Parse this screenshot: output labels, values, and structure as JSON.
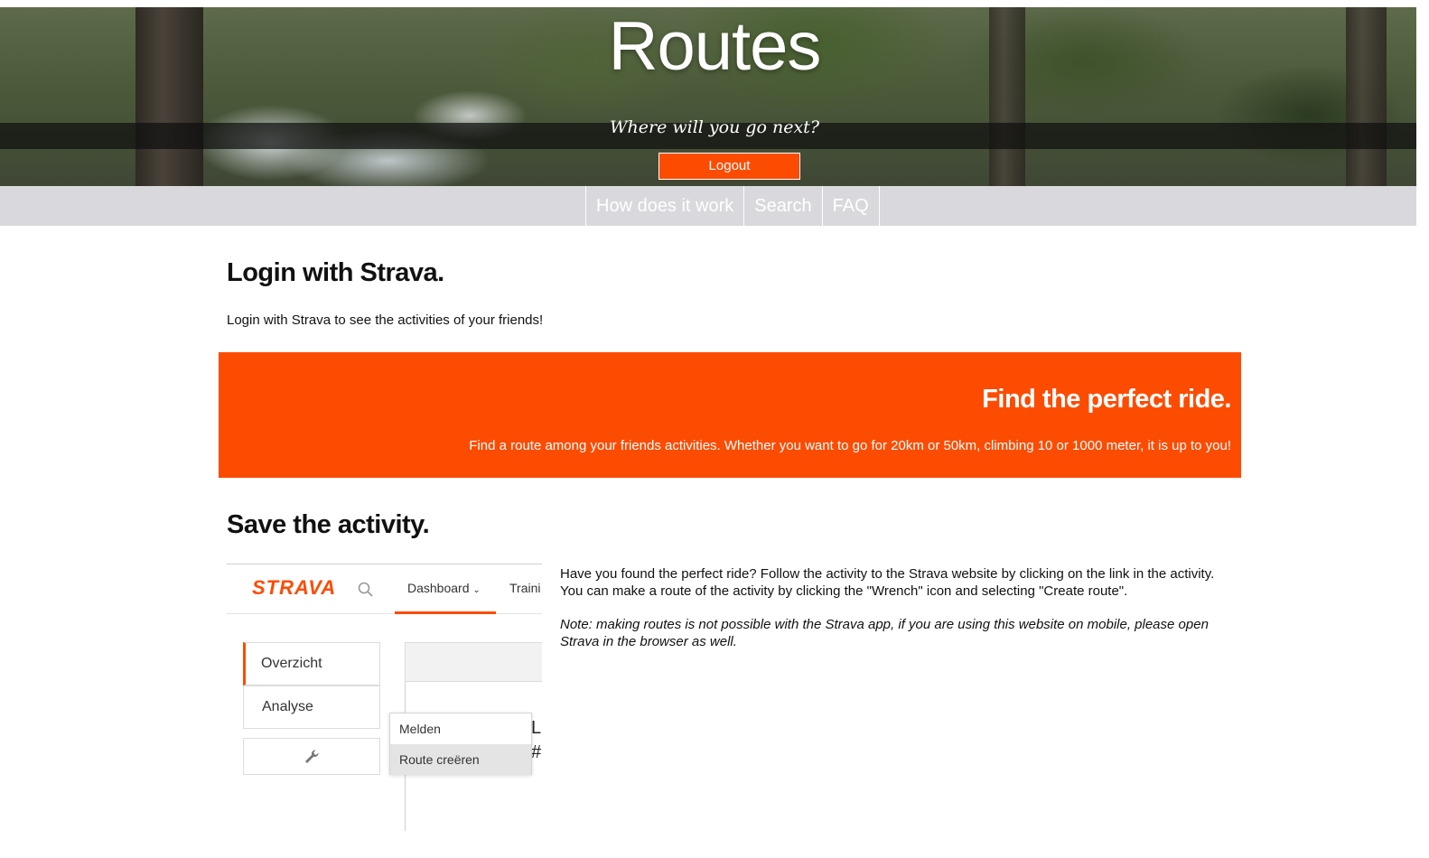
{
  "hero": {
    "title": "Routes",
    "tagline": "Where will you go next?",
    "logout_label": "Logout"
  },
  "nav": {
    "items": [
      {
        "label": "How does it work"
      },
      {
        "label": "Search"
      },
      {
        "label": "FAQ"
      }
    ]
  },
  "login": {
    "heading": "Login with Strava.",
    "text": "Login with Strava to see the activities of your friends!"
  },
  "promo": {
    "heading": "Find the perfect ride.",
    "text": "Find a route among your friends activities. Whether you want to go for 20km or 50km, climbing 10 or 1000 meter, it is up to you!",
    "background_color": "#fc4c02"
  },
  "save": {
    "heading": "Save the activity.",
    "description": "Have you found the perfect ride? Follow the activity to the Strava website by clicking on the link in the activity. You can make a route of the activity by clicking the \"Wrench\" icon and selecting \"Create route\".",
    "note": "Note: making routes is not possible with the Strava app, if you are using this website on mobile, please open Strava in the browser as well."
  },
  "strava_screenshot": {
    "logo": "STRAVA",
    "nav_dashboard": "Dashboard",
    "nav_training": "Traini",
    "sidebar": [
      "Overzicht",
      "Analyse"
    ],
    "menu": [
      "Melden",
      "Route creëren"
    ],
    "icon_search": "search-icon",
    "icon_wrench": "wrench-icon"
  }
}
